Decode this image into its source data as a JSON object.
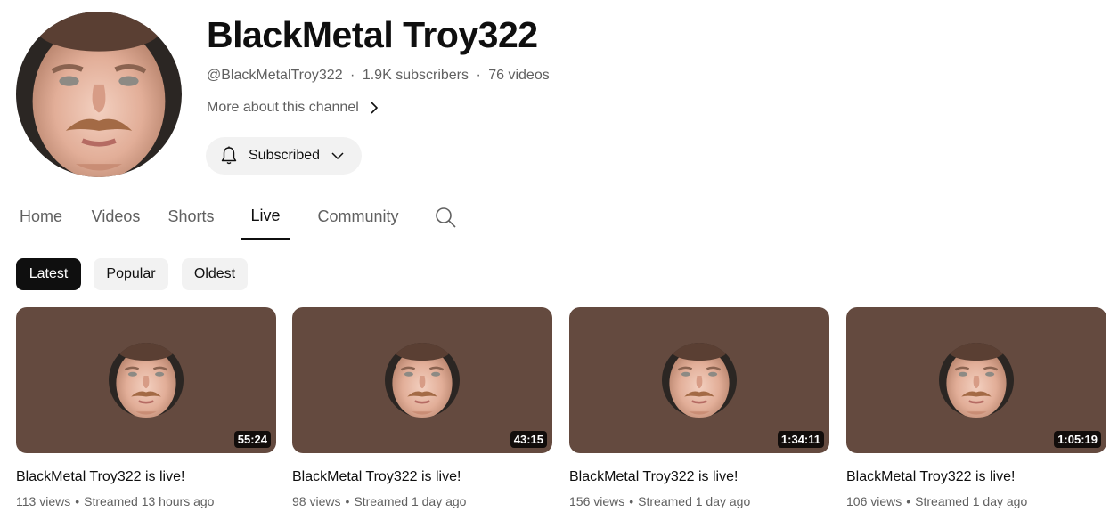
{
  "channel": {
    "name": "BlackMetal Troy322",
    "handle": "@BlackMetalTroy322",
    "subscribers": "1.9K subscribers",
    "videos": "76 videos",
    "meta_separator": "·",
    "more_about": "More about this channel",
    "subscribe_label": "Subscribed"
  },
  "tabs": [
    {
      "label": "Home"
    },
    {
      "label": "Videos"
    },
    {
      "label": "Shorts"
    },
    {
      "label": "Live",
      "active": true
    },
    {
      "label": "Community"
    }
  ],
  "chips": [
    {
      "label": "Latest",
      "active": true
    },
    {
      "label": "Popular"
    },
    {
      "label": "Oldest"
    }
  ],
  "videos": [
    {
      "title": "BlackMetal Troy322 is live!",
      "duration": "55:24",
      "views": "113 views",
      "streamed": "Streamed 13 hours ago"
    },
    {
      "title": "BlackMetal Troy322 is live!",
      "duration": "43:15",
      "views": "98 views",
      "streamed": "Streamed 1 day ago"
    },
    {
      "title": "BlackMetal Troy322 is live!",
      "duration": "1:34:11",
      "views": "156 views",
      "streamed": "Streamed 1 day ago"
    },
    {
      "title": "BlackMetal Troy322 is live!",
      "duration": "1:05:19",
      "views": "106 views",
      "streamed": "Streamed 1 day ago"
    }
  ],
  "meta_bullet": "•",
  "colors": {
    "thumbnail_bg": "#644a3f",
    "active_chip": "#0f0f0f",
    "chip_bg": "#f2f2f2",
    "secondary_text": "#606060"
  },
  "icons": {
    "search": "search-icon",
    "bell": "bell-icon",
    "chevron_right": "chevron-right-icon",
    "chevron_down": "chevron-down-icon"
  }
}
